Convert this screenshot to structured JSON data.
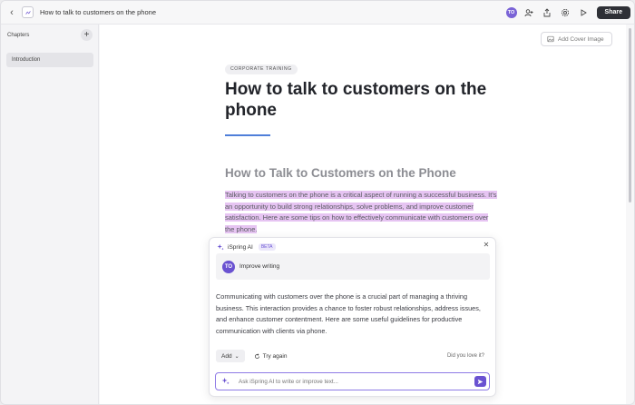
{
  "window": {
    "title": "How to talk to customers on the phone",
    "avatar_initials": "TO",
    "share_label": "Share"
  },
  "sidebar": {
    "title": "Chapters",
    "items": [
      {
        "label": "Introduction"
      }
    ]
  },
  "main": {
    "cover_button": "Add Cover Image",
    "tag": "CORPORATE TRAINING",
    "heading": "How to talk to customers on the phone",
    "subheading": "How to Talk to Customers on the Phone",
    "paragraph": "Talking to customers on the phone is a critical aspect of running a successful business. It's an opportunity to build strong relationships, solve problems, and improve customer satisfaction. Here are some tips on how to effectively communicate with customers over the phone.",
    "accent_color": "#4f7fd9",
    "highlight_color": "#e6c4f2"
  },
  "ai_panel": {
    "title": "iSpring AI",
    "badge": "BETA",
    "prompt_avatar": "TO",
    "prompt": "Improve writing",
    "result": "Communicating with customers over the phone is a crucial part of managing a thriving business. This interaction provides a chance to foster robust relationships, address issues, and enhance customer contentment. Here are some useful guidelines for productive communication with clients via phone.",
    "add_label": "Add",
    "try_again_label": "Try again",
    "feedback_label": "Did you love it?",
    "input_placeholder": "Ask iSpring AI to write or improve text...",
    "accent_color": "#6a52d1"
  }
}
